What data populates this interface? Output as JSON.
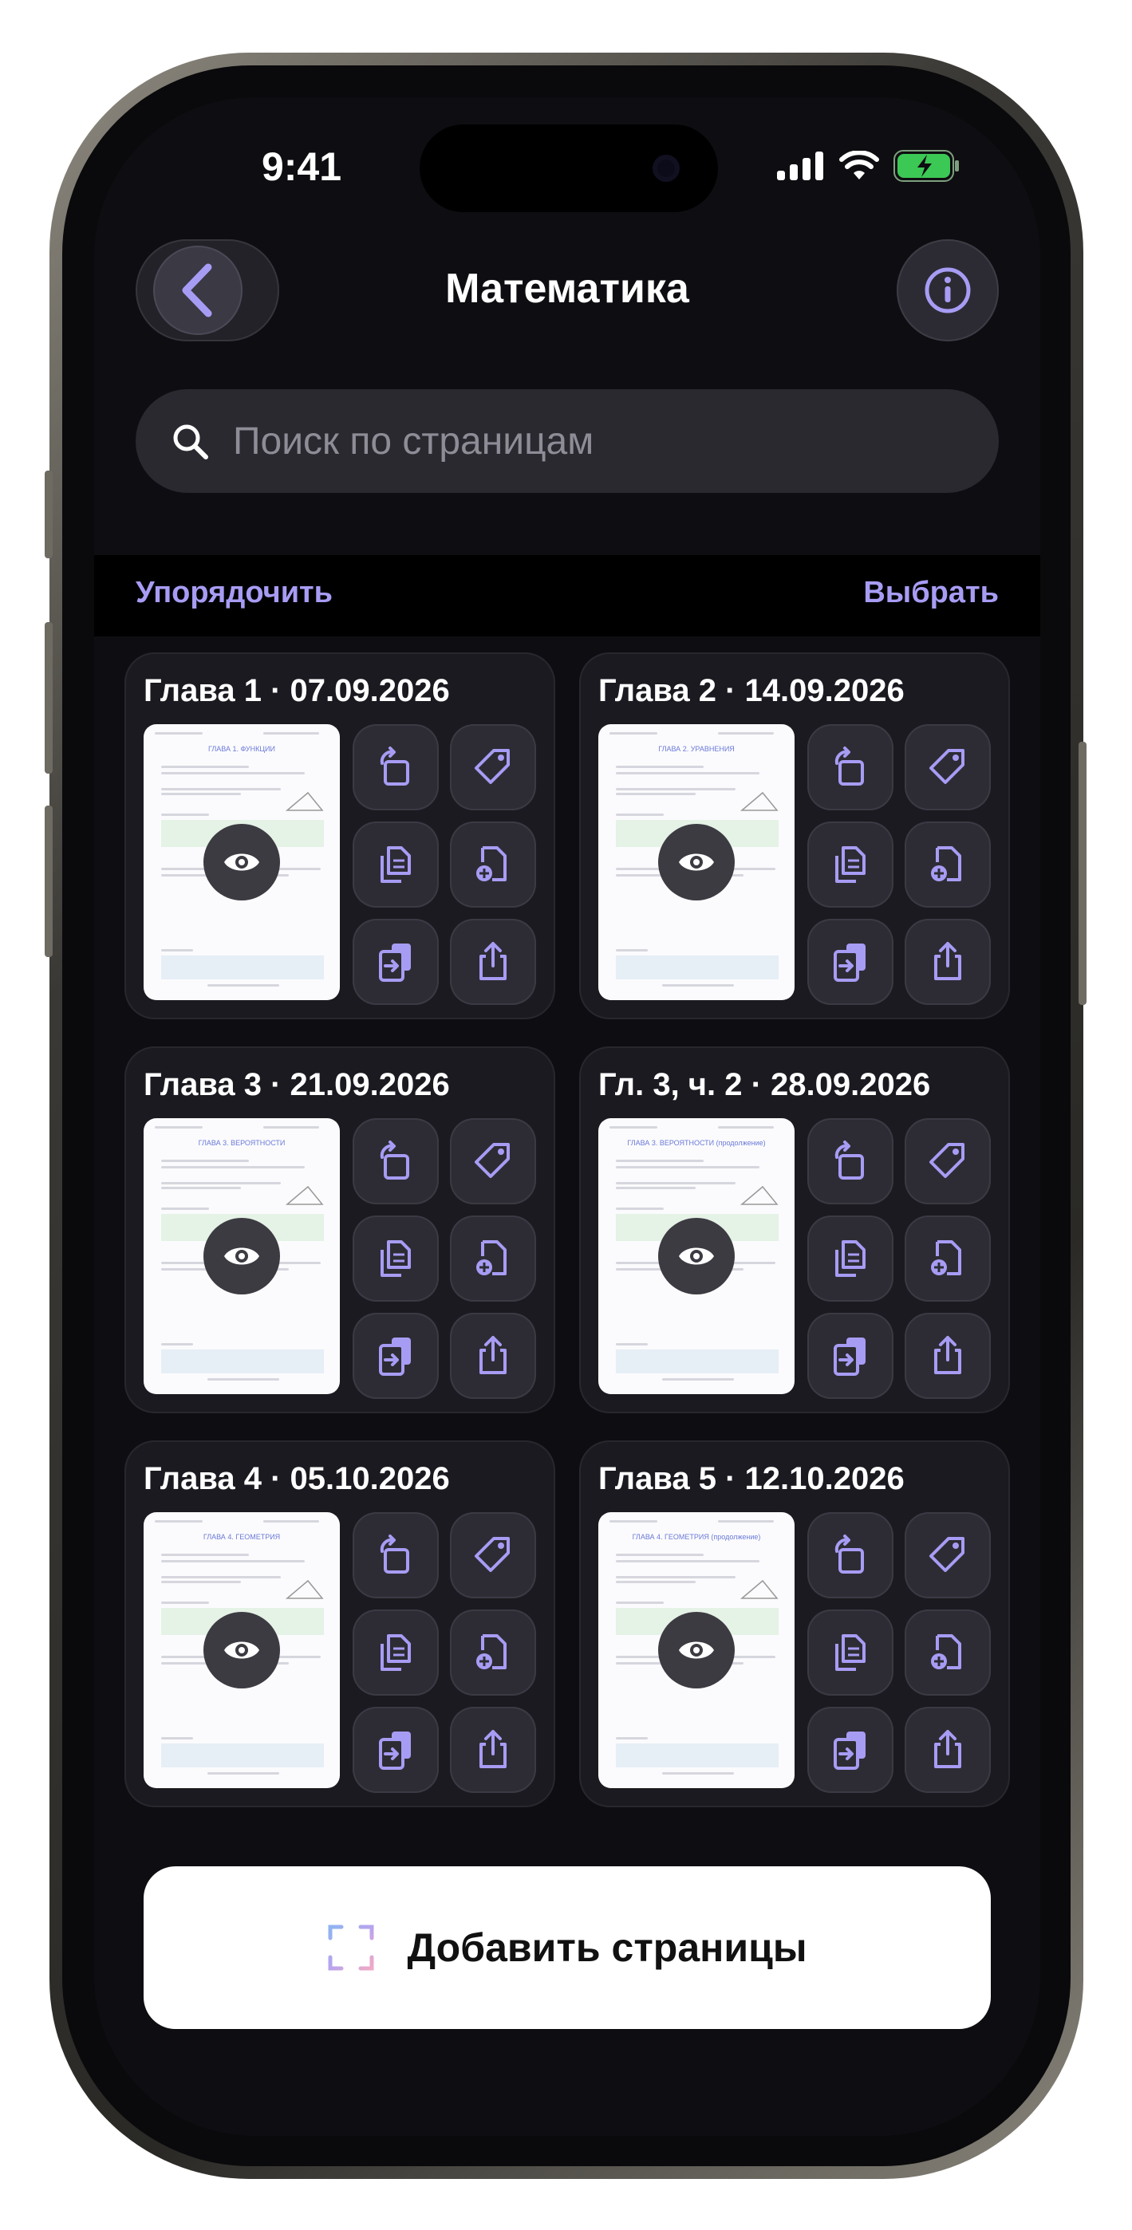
{
  "status_bar": {
    "time": "9:41"
  },
  "header": {
    "title": "Математика",
    "back_icon": "chevron-left-icon",
    "info_icon": "info-icon"
  },
  "search": {
    "placeholder": "Поиск по страницам",
    "icon": "search-icon"
  },
  "toolbar": {
    "sort_label": "Упорядочить",
    "select_label": "Выбрать"
  },
  "cards": [
    {
      "title": "Глава 1 · 07.09.2026",
      "page_heading": "ГЛАВА 1. ФУНКЦИИ"
    },
    {
      "title": "Глава 2 · 14.09.2026",
      "page_heading": "ГЛАВА 2. УРАВНЕНИЯ"
    },
    {
      "title": "Глава 3 · 21.09.2026",
      "page_heading": "ГЛАВА 3. ВЕРОЯТНОСТИ"
    },
    {
      "title": "Гл. 3, ч. 2 · 28.09.2026",
      "page_heading": "ГЛАВА 3. ВЕРОЯТНОСТИ (продолжение)"
    },
    {
      "title": "Глава 4 · 05.10.2026",
      "page_heading": "ГЛАВА 4. ГЕОМЕТРИЯ"
    },
    {
      "title": "Глава 5 · 12.10.2026",
      "page_heading": "ГЛАВА 4. ГЕОМЕТРИЯ (продолжение)"
    }
  ],
  "card_actions": [
    "rotate-icon",
    "tag-icon",
    "duplicate-icon",
    "add-page-icon",
    "move-icon",
    "share-icon"
  ],
  "add_button": {
    "label": "Добавить страницы",
    "icon": "scan-icon"
  },
  "colors": {
    "accent": "#a79cf4",
    "background": "#0e0d11",
    "card": "#1b1a20"
  }
}
